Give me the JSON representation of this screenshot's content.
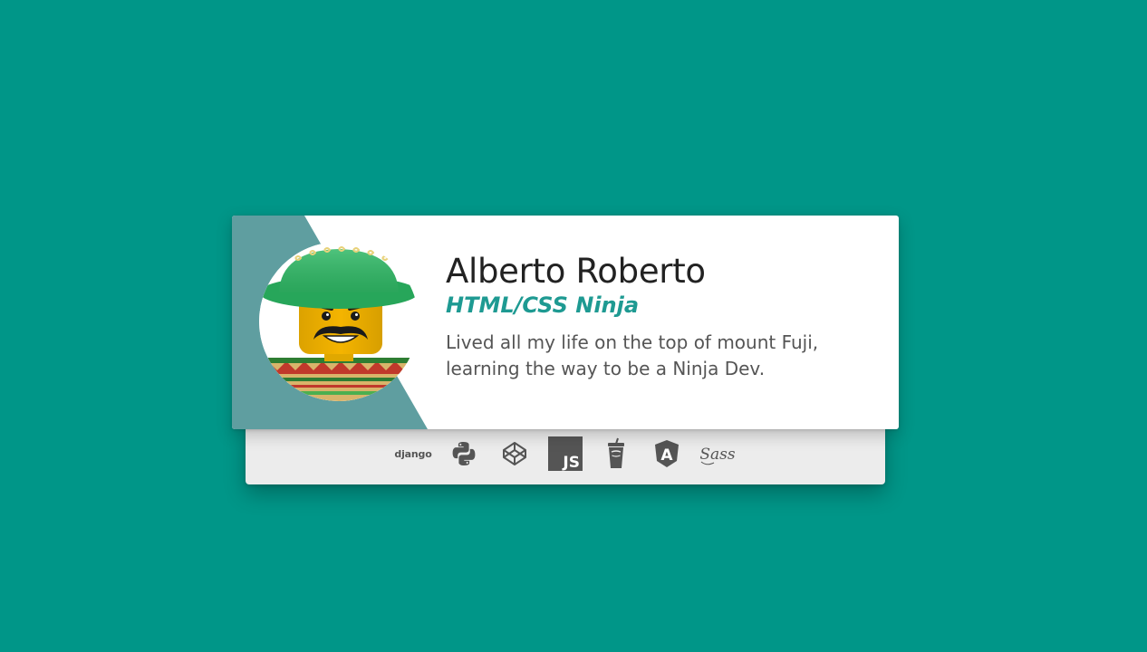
{
  "profile": {
    "name": "Alberto Roberto",
    "role": "HTML/CSS Ninja",
    "bio": "Lived all my life on the top of mount Fuji, learning the way to be a Ninja Dev.",
    "avatar_icon": "lego-mariachi-avatar"
  },
  "skills": [
    {
      "name": "django",
      "label": "django",
      "icon": "django-icon"
    },
    {
      "name": "python",
      "icon": "python-icon"
    },
    {
      "name": "codepen",
      "icon": "codepen-icon"
    },
    {
      "name": "javascript",
      "label": "JS",
      "icon": "js-icon"
    },
    {
      "name": "gulp",
      "icon": "gulp-icon"
    },
    {
      "name": "angular",
      "label": "A",
      "icon": "angular-icon"
    },
    {
      "name": "sass",
      "label": "Sass",
      "icon": "sass-icon"
    }
  ],
  "colors": {
    "background": "#009688",
    "accent": "#1e9a92",
    "diagonal": "#5f9ea0",
    "card": "#ffffff",
    "tray": "#ececec"
  }
}
